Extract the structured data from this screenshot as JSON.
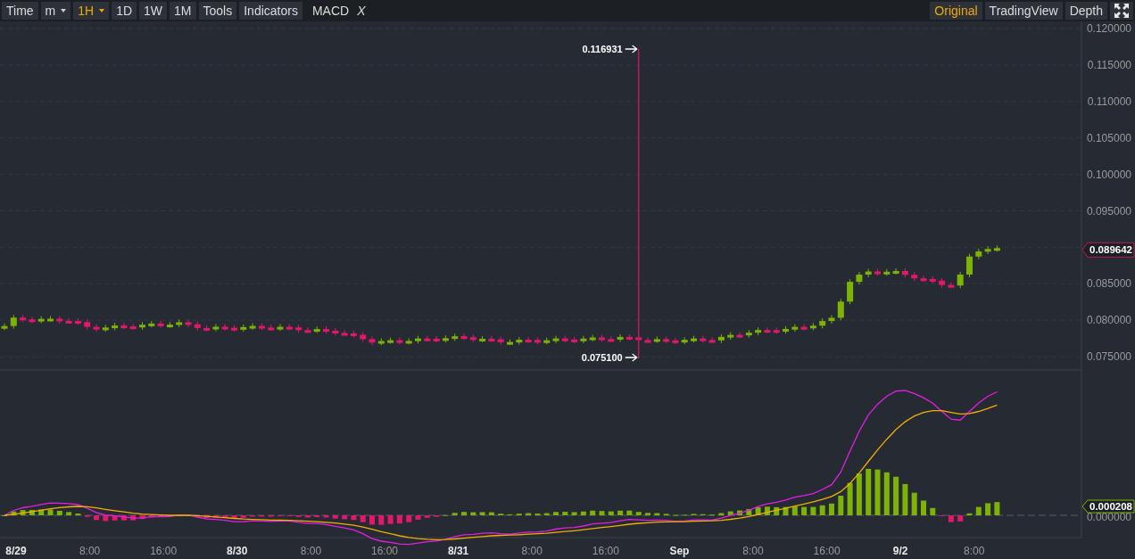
{
  "toolbar": {
    "buttons": [
      {
        "label": "Time",
        "kind": "button",
        "selected": false
      },
      {
        "label": "m",
        "kind": "dropdown",
        "selected": false
      },
      {
        "label": "1H",
        "kind": "dropdown",
        "selected": true
      },
      {
        "label": "1D",
        "kind": "button",
        "selected": false
      },
      {
        "label": "1W",
        "kind": "button",
        "selected": false
      },
      {
        "label": "1M",
        "kind": "button",
        "selected": false
      },
      {
        "label": "Tools",
        "kind": "button",
        "selected": false
      },
      {
        "label": "Indicators",
        "kind": "button",
        "selected": false
      }
    ],
    "indicator": {
      "label": "MACD",
      "close": "X"
    },
    "views": [
      {
        "label": "Original",
        "selected": true
      },
      {
        "label": "TradingView",
        "selected": false
      },
      {
        "label": "Depth",
        "selected": false
      }
    ]
  },
  "price_chart": {
    "y_axis": [
      "0.120000",
      "0.115000",
      "0.110000",
      "0.105000",
      "0.100000",
      "0.095000",
      "0.085000",
      "0.080000",
      "0.075000"
    ],
    "high_marker": "0.116931",
    "low_marker": "0.075100",
    "last_price": "0.089642"
  },
  "macd_chart": {
    "last_value": "0.000208",
    "zero_label": "0.000000"
  },
  "x_axis": [
    {
      "label": "8/29",
      "major": true
    },
    {
      "label": "8:00",
      "major": false
    },
    {
      "label": "16:00",
      "major": false
    },
    {
      "label": "8/30",
      "major": true
    },
    {
      "label": "8:00",
      "major": false
    },
    {
      "label": "16:00",
      "major": false
    },
    {
      "label": "8/31",
      "major": true
    },
    {
      "label": "8:00",
      "major": false
    },
    {
      "label": "16:00",
      "major": false
    },
    {
      "label": "Sep",
      "major": true
    },
    {
      "label": "8:00",
      "major": false
    },
    {
      "label": "16:00",
      "major": false
    },
    {
      "label": "9/2",
      "major": true
    },
    {
      "label": "8:00",
      "major": false
    }
  ]
}
